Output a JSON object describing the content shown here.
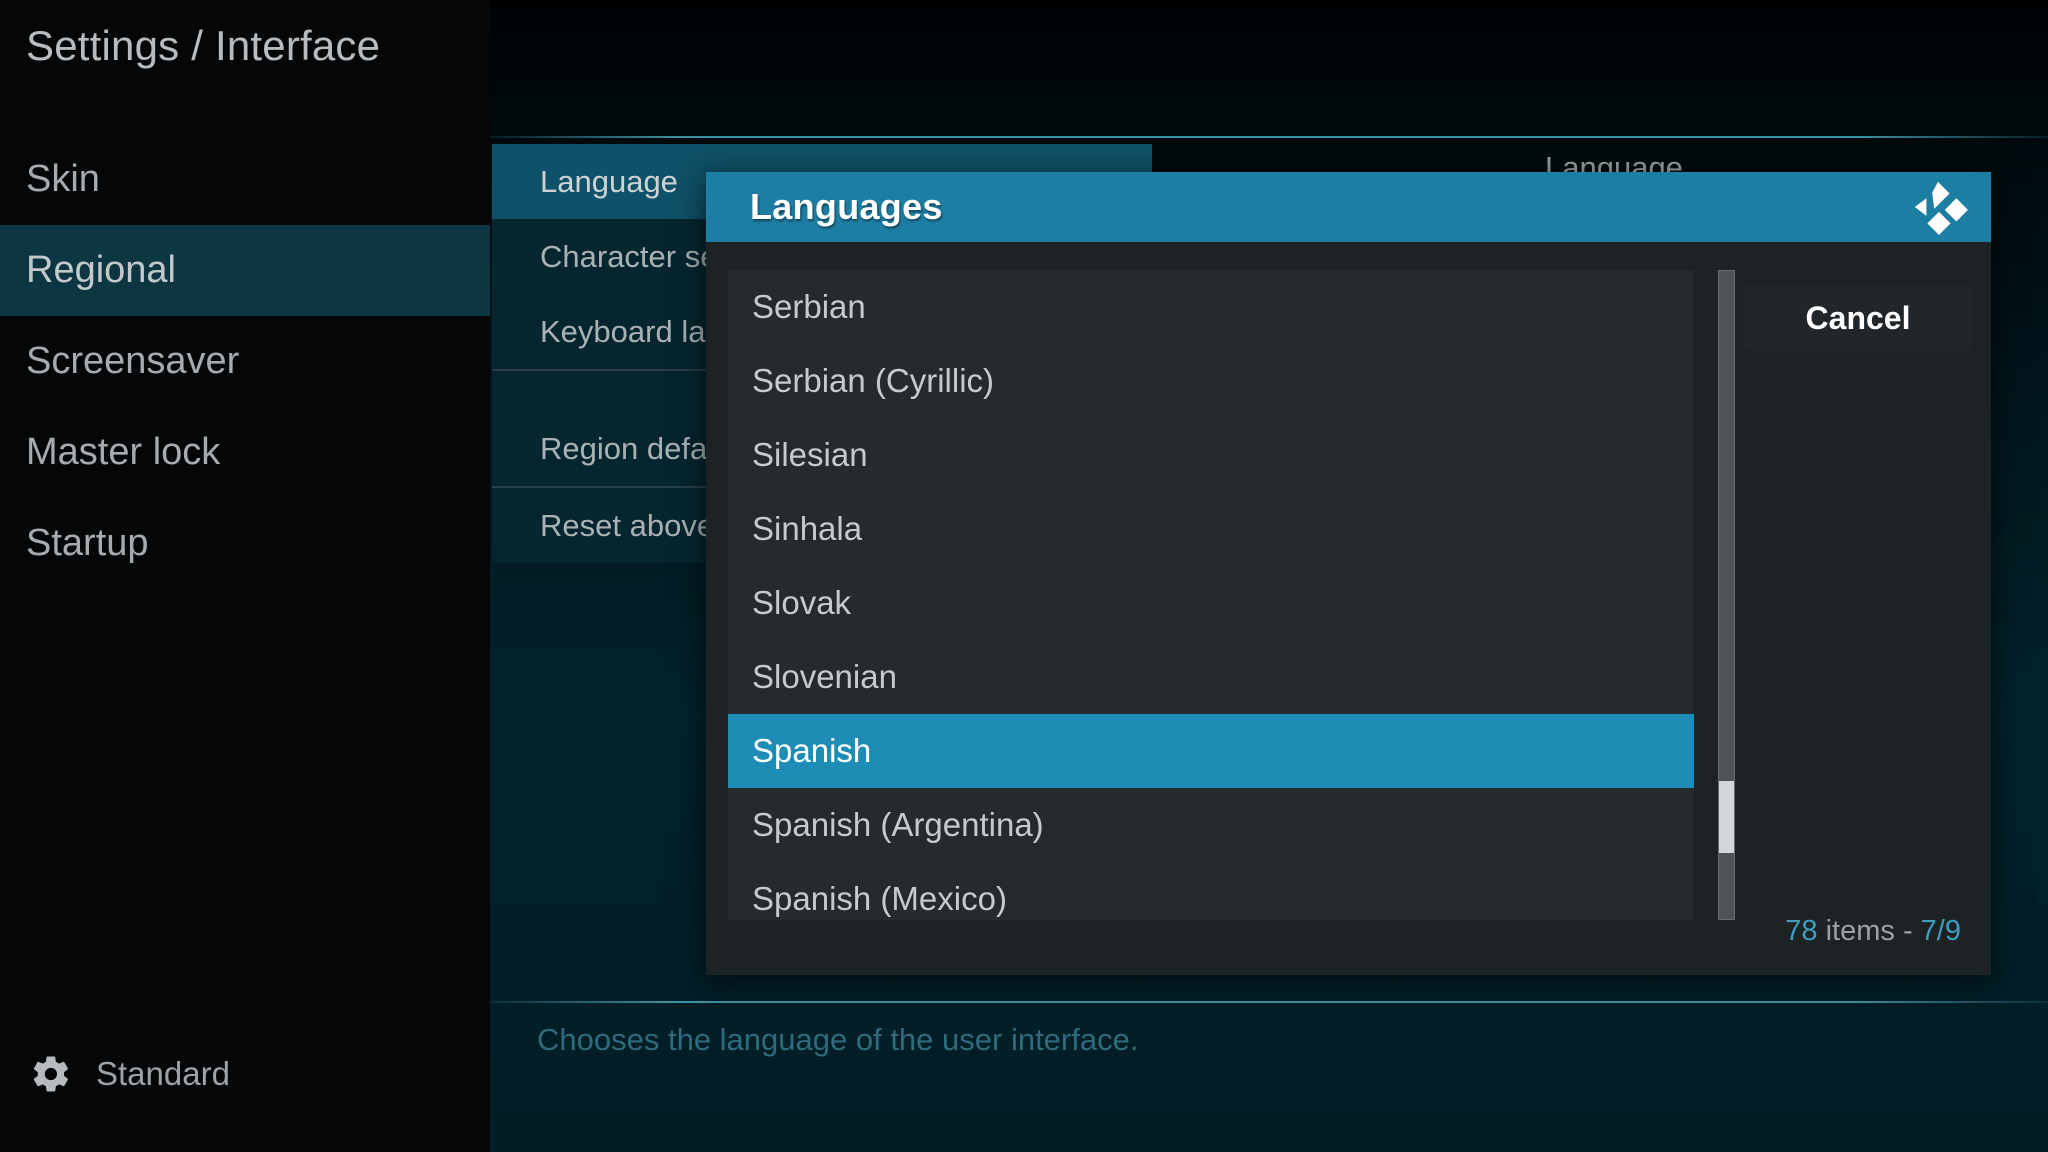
{
  "window": {
    "page_title": "Settings / Interface"
  },
  "sidebar": {
    "items": [
      {
        "label": "Skin",
        "selected": false
      },
      {
        "label": "Regional",
        "selected": true
      },
      {
        "label": "Screensaver",
        "selected": false
      },
      {
        "label": "Master lock",
        "selected": false
      },
      {
        "label": "Startup",
        "selected": false
      }
    ],
    "profile": {
      "icon": "gear-icon",
      "label": "Standard"
    }
  },
  "settings_panel": {
    "rows": [
      {
        "label": "Language",
        "selected": true
      },
      {
        "label": "Character se",
        "selected": false
      },
      {
        "label": "Keyboard la",
        "selected": false
      },
      {
        "label": "Region defa",
        "selected": false
      },
      {
        "label": "Reset above",
        "selected": false
      }
    ],
    "value_column_label": "Language",
    "help_text": "Chooses the language of the user interface."
  },
  "dialog": {
    "title": "Languages",
    "logo_icon": "kodi-logo-icon",
    "cancel_label": "Cancel",
    "items": [
      {
        "label": "Serbian",
        "selected": false
      },
      {
        "label": "Serbian (Cyrillic)",
        "selected": false
      },
      {
        "label": "Silesian",
        "selected": false
      },
      {
        "label": "Sinhala",
        "selected": false
      },
      {
        "label": "Slovak",
        "selected": false
      },
      {
        "label": "Slovenian",
        "selected": false
      },
      {
        "label": "Spanish",
        "selected": true
      },
      {
        "label": "Spanish (Argentina)",
        "selected": false
      },
      {
        "label": "Spanish (Mexico)",
        "selected": false
      }
    ],
    "status": {
      "total_items": "78",
      "middle_text": " items - ",
      "position": "7/9"
    }
  },
  "colors": {
    "accent_teal": "#1d8db5",
    "header_teal": "#1d7ea3",
    "sidebar_selected": "#0d3643",
    "dialog_bg": "#1d2225",
    "list_bg": "#242a2d",
    "help_text": "#2f6b7d",
    "count_number": "#3f9dc0"
  }
}
